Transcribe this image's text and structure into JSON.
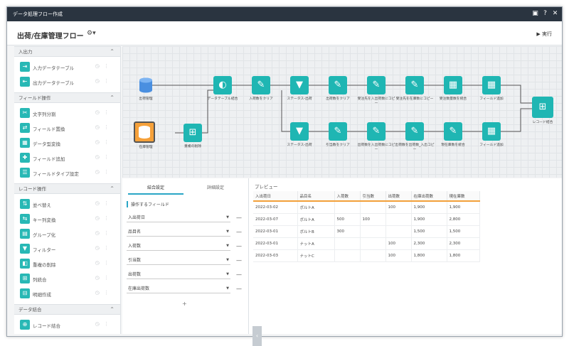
{
  "window": {
    "title": "データ処理フロー作成"
  },
  "header": {
    "flow_name": "出荷/在庫管理フロー",
    "gear": "⚙▾",
    "run_label": "▶ 実行"
  },
  "sidebar": {
    "sections": [
      {
        "title": "入出力",
        "items": [
          {
            "label": "入力データテーブル",
            "icon": "⇥"
          },
          {
            "label": "出力データテーブル",
            "icon": "⇤"
          }
        ]
      },
      {
        "title": "フィールド操作",
        "items": [
          {
            "label": "文字列分割",
            "icon": "✂"
          },
          {
            "label": "フィールド置換",
            "icon": "⇄"
          },
          {
            "label": "データ型変換",
            "icon": "▦"
          },
          {
            "label": "フィールド追加",
            "icon": "✚"
          },
          {
            "label": "フィールドタイプ設定",
            "icon": "☰"
          }
        ]
      },
      {
        "title": "レコード操作",
        "items": [
          {
            "label": "並べ替え",
            "icon": "⇅"
          },
          {
            "label": "キー列変換",
            "icon": "⇆"
          },
          {
            "label": "グループ化",
            "icon": "▤"
          },
          {
            "label": "フィルター",
            "icon": "▼"
          },
          {
            "label": "重複の削除",
            "icon": "◧"
          },
          {
            "label": "列統合",
            "icon": "⊞"
          },
          {
            "label": "明細作成",
            "icon": "⊟"
          }
        ]
      },
      {
        "title": "データ結合",
        "items": [
          {
            "label": "レコード結合",
            "icon": "⊕"
          }
        ]
      }
    ]
  },
  "canvas": {
    "nodes": [
      {
        "label": "出荷管理"
      },
      {
        "label": "在庫管理"
      },
      {
        "label": "重複の削除"
      },
      {
        "label": "データテーブル結合"
      },
      {
        "label": "入荷数をクリア"
      },
      {
        "label": "ステータス-出荷"
      },
      {
        "label": "出荷数をクリア"
      },
      {
        "label": "受注先を入出荷数にコピー"
      },
      {
        "label": "受注先を在庫数にコピー"
      },
      {
        "label": "受注数量数を統合"
      },
      {
        "label": "フィールド追加"
      },
      {
        "label": "ステータス-出荷"
      },
      {
        "label": "引当数をクリア"
      },
      {
        "label": "出荷数を入出荷数にコピー"
      },
      {
        "label": "出荷数を出荷数_入出コピー"
      },
      {
        "label": "現在庫数を統合"
      },
      {
        "label": "フィールド追加"
      },
      {
        "label": "レコード結合"
      }
    ]
  },
  "config_panel": {
    "tabs": [
      "結合設定",
      "詳細設定"
    ],
    "field_heading": "操作するフィールド",
    "fields": [
      "入出荷日",
      "品目名",
      "入荷数",
      "引当数",
      "出荷数",
      "在庫出荷数"
    ],
    "add": "+"
  },
  "preview": {
    "title": "プレビュー",
    "columns": [
      "入出荷日",
      "品目名",
      "入荷数",
      "引当数",
      "出荷数",
      "在庫出荷数",
      "現在庫数"
    ],
    "rows": [
      [
        "2022-03-02",
        "ボルトA",
        "",
        "",
        "100",
        "1,900",
        "1,900"
      ],
      [
        "2022-03-07",
        "ボルトA",
        "500",
        "100",
        "",
        "1,900",
        "2,800"
      ],
      [
        "2022-03-01",
        "ボルトB",
        "300",
        "",
        "",
        "1,500",
        "1,500"
      ],
      [
        "2022-03-01",
        "ナットA",
        "",
        "",
        "100",
        "2,300",
        "2,300"
      ],
      [
        "2022-03-03",
        "ナットC",
        "",
        "",
        "100",
        "1,800",
        "1,800"
      ]
    ]
  }
}
